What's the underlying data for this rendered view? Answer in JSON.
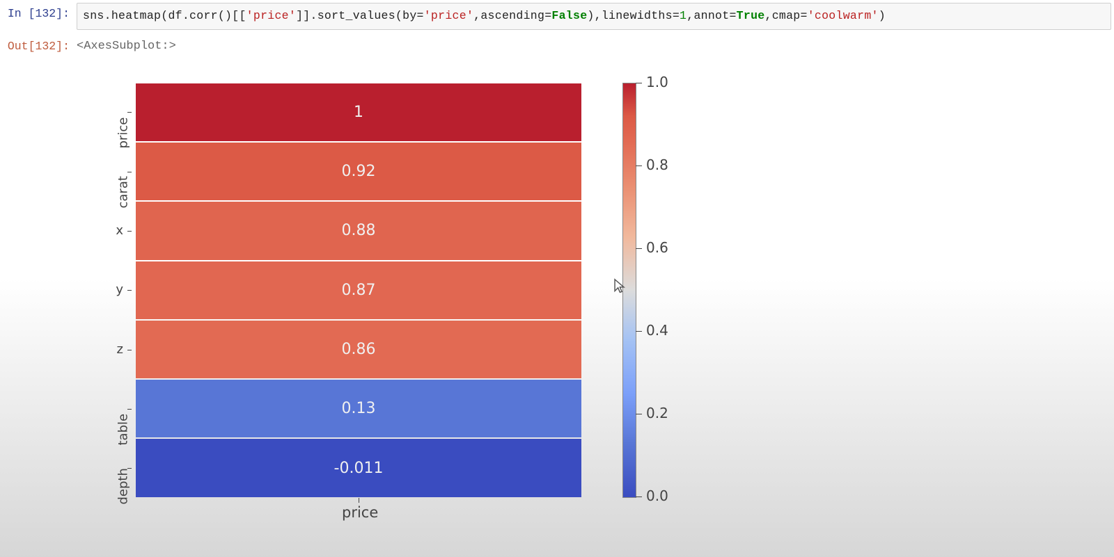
{
  "cell": {
    "exec_count": 132,
    "in_prompt": "In [132]:",
    "out_prompt": "Out[132]:",
    "output_repr": "<AxesSubplot:>",
    "code_tokens": [
      {
        "t": "sns",
        "c": "tok-def"
      },
      {
        "t": ".",
        "c": "tok-def"
      },
      {
        "t": "heatmap",
        "c": "tok-def"
      },
      {
        "t": "(",
        "c": "tok-def"
      },
      {
        "t": "df",
        "c": "tok-def"
      },
      {
        "t": ".",
        "c": "tok-def"
      },
      {
        "t": "corr",
        "c": "tok-def"
      },
      {
        "t": "()[[",
        "c": "tok-def"
      },
      {
        "t": "'price'",
        "c": "tok-str"
      },
      {
        "t": "]].",
        "c": "tok-def"
      },
      {
        "t": "sort_values",
        "c": "tok-def"
      },
      {
        "t": "(",
        "c": "tok-def"
      },
      {
        "t": "by",
        "c": "tok-def"
      },
      {
        "t": "=",
        "c": "tok-def"
      },
      {
        "t": "'price'",
        "c": "tok-str"
      },
      {
        "t": ",",
        "c": "tok-def"
      },
      {
        "t": "ascending",
        "c": "tok-def"
      },
      {
        "t": "=",
        "c": "tok-def"
      },
      {
        "t": "False",
        "c": "tok-kw"
      },
      {
        "t": "),",
        "c": "tok-def"
      },
      {
        "t": "linewidths",
        "c": "tok-def"
      },
      {
        "t": "=",
        "c": "tok-def"
      },
      {
        "t": "1",
        "c": "tok-num"
      },
      {
        "t": ",",
        "c": "tok-def"
      },
      {
        "t": "annot",
        "c": "tok-def"
      },
      {
        "t": "=",
        "c": "tok-def"
      },
      {
        "t": "True",
        "c": "tok-kw"
      },
      {
        "t": ",",
        "c": "tok-def"
      },
      {
        "t": "cmap",
        "c": "tok-def"
      },
      {
        "t": "=",
        "c": "tok-def"
      },
      {
        "t": "'coolwarm'",
        "c": "tok-str"
      },
      {
        "t": ")",
        "c": "tok-def"
      }
    ]
  },
  "chart_data": {
    "type": "heatmap",
    "xlabel": "price",
    "y_categories": [
      "price",
      "carat",
      "x",
      "y",
      "z",
      "table",
      "depth"
    ],
    "column": "price",
    "values": [
      1,
      0.92,
      0.88,
      0.87,
      0.86,
      0.13,
      -0.011
    ],
    "annotations": [
      "1",
      "0.92",
      "0.88",
      "0.87",
      "0.86",
      "0.13",
      "-0.011"
    ],
    "cmap": "coolwarm",
    "value_range": [
      0.0,
      1.0
    ],
    "colorbar_ticks": [
      1.0,
      0.8,
      0.6,
      0.4,
      0.2,
      0.0
    ],
    "colorbar_tick_labels": [
      "1.0",
      "0.8",
      "0.6",
      "0.4",
      "0.2",
      "0.0"
    ],
    "linewidths": 1,
    "annot": true
  },
  "colors": {
    "coolwarm_stops": [
      {
        "p": 0.0,
        "h": "#3a4cc0"
      },
      {
        "p": 0.13,
        "h": "#5876d6"
      },
      {
        "p": 0.25,
        "h": "#7b9ff9"
      },
      {
        "p": 0.38,
        "h": "#a4c2f4"
      },
      {
        "p": 0.5,
        "h": "#dcdcdc"
      },
      {
        "p": 0.63,
        "h": "#f1b89c"
      },
      {
        "p": 0.75,
        "h": "#ea8f72"
      },
      {
        "p": 0.86,
        "h": "#e26a53"
      },
      {
        "p": 0.92,
        "h": "#dc5a46"
      },
      {
        "p": 1.0,
        "h": "#b91f2e"
      }
    ]
  }
}
